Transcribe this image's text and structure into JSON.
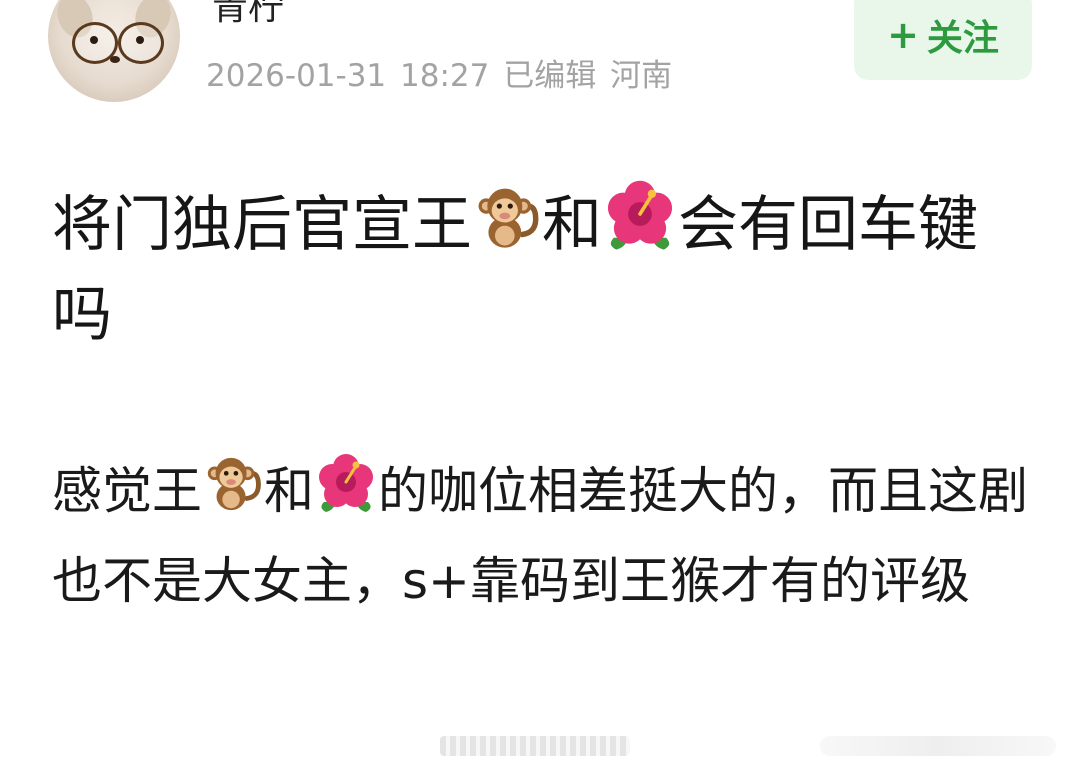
{
  "post": {
    "author": {
      "name": "青柠"
    },
    "meta": {
      "timestamp": "2026-01-31 18:27",
      "edited": "已编辑",
      "location": "河南"
    },
    "follow_button": {
      "plus": "+",
      "label": "关注"
    },
    "title": {
      "part1": "将门独后官宣王",
      "part2": "和",
      "part3": "会有回车键吗"
    },
    "body": {
      "part1": "感觉王",
      "part2": "和",
      "part3": "的咖位相差挺大的，而且这剧也不是大女主，s+靠码到王猴才有的评级"
    },
    "emoji": {
      "monkey": "monkey-emoji",
      "hibiscus": "hibiscus-emoji"
    },
    "colors": {
      "follow_bg": "#e8f7ea",
      "follow_text": "#2e9a3f",
      "meta_text": "#a3a3a3"
    }
  }
}
